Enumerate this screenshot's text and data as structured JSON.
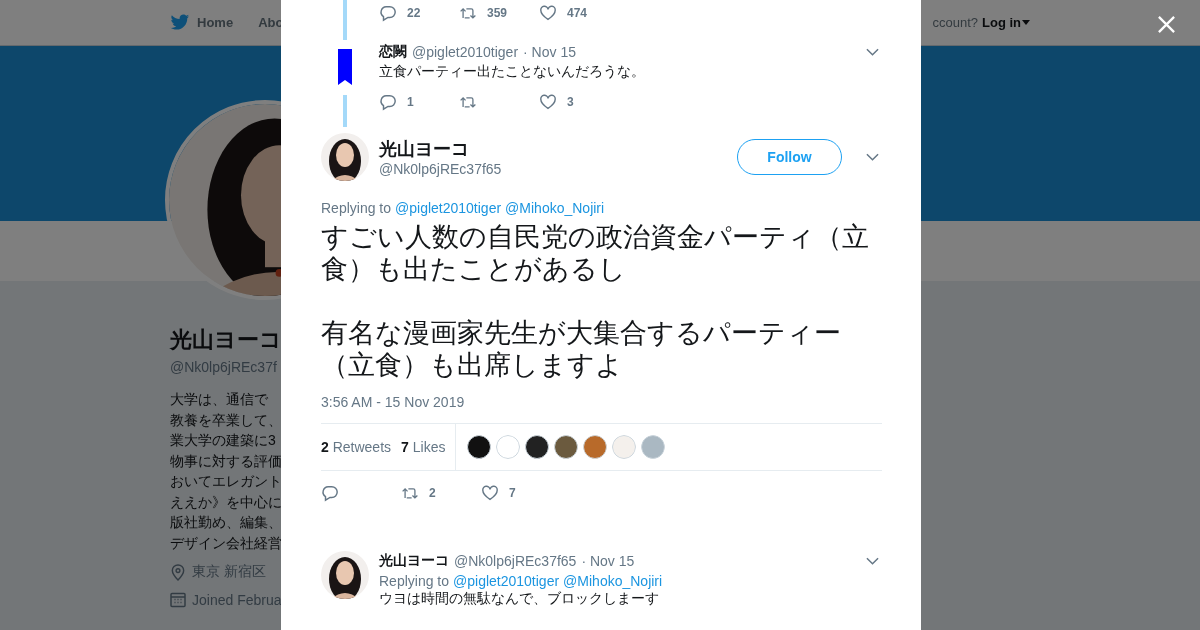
{
  "background_page": {
    "nav": [
      {
        "label": "Home"
      },
      {
        "label": "Abo"
      }
    ],
    "login_prompt": "ccount?",
    "login_link": "Log in",
    "profile": {
      "name": "光山ヨーコ",
      "handle": "@Nk0lp6jREc37f",
      "bio_lines": [
        "大学は、通信で",
        "教養を卒業して、",
        "業大学の建築に3",
        "物事に対する評価",
        "おいてエレガント",
        "ええか》を中心に",
        "版社勤め、編集、",
        "デザイン会社経営"
      ],
      "location": "東京 新宿区",
      "joined": "Joined Februa"
    }
  },
  "modal": {
    "thread_above": {
      "actions": [
        {
          "kind": "reply",
          "count": "22"
        },
        {
          "kind": "retweet",
          "count": "359"
        },
        {
          "kind": "like",
          "count": "474"
        }
      ]
    },
    "parent_tweet": {
      "name": "恋闕",
      "handle": "@piglet2010tiger",
      "date": "· Nov 15",
      "text": "立食パーティー出たことないんだろうな。",
      "actions": [
        {
          "kind": "reply",
          "count": "1"
        },
        {
          "kind": "retweet"
        },
        {
          "kind": "like",
          "count": "3"
        }
      ]
    },
    "main_tweet": {
      "name": "光山ヨーコ",
      "handle": "@Nk0lp6jREc37f65",
      "follow_button": "Follow",
      "replying_label": "Replying to",
      "replying_to": [
        "@piglet2010tiger",
        "@Mihoko_Nojiri"
      ],
      "paragraphs": [
        "すごい人数の自民党の政治資金パーティ（立食）も出たことがあるし",
        "有名な漫画家先生が大集合するパーティー（立食）も出席しますよ"
      ],
      "timestamp": "3:56 AM - 15 Nov 2019",
      "stats": [
        {
          "count": "2",
          "label": "Retweets"
        },
        {
          "count": "7",
          "label": "Likes"
        }
      ],
      "likers": [
        {
          "color": "#111111"
        },
        {
          "color": "#ffffff"
        },
        {
          "color": "#222222"
        },
        {
          "color": "#6b5a3e"
        },
        {
          "color": "#b86a2a"
        },
        {
          "color": "#f4f0ec"
        },
        {
          "color": "#aab8c2"
        }
      ],
      "actions": [
        {
          "kind": "reply"
        },
        {
          "kind": "retweet",
          "count": "2"
        },
        {
          "kind": "like",
          "count": "7"
        }
      ]
    },
    "replies": [
      {
        "name": "光山ヨーコ",
        "handle": "@Nk0lp6jREc37f65",
        "date": "· Nov 15",
        "replying_label": "Replying to",
        "replying_to": [
          "@piglet2010tiger",
          "@Mihoko_Nojiri"
        ],
        "text": "ウヨは時間の無駄なんで、ブロックしまーす"
      }
    ]
  }
}
